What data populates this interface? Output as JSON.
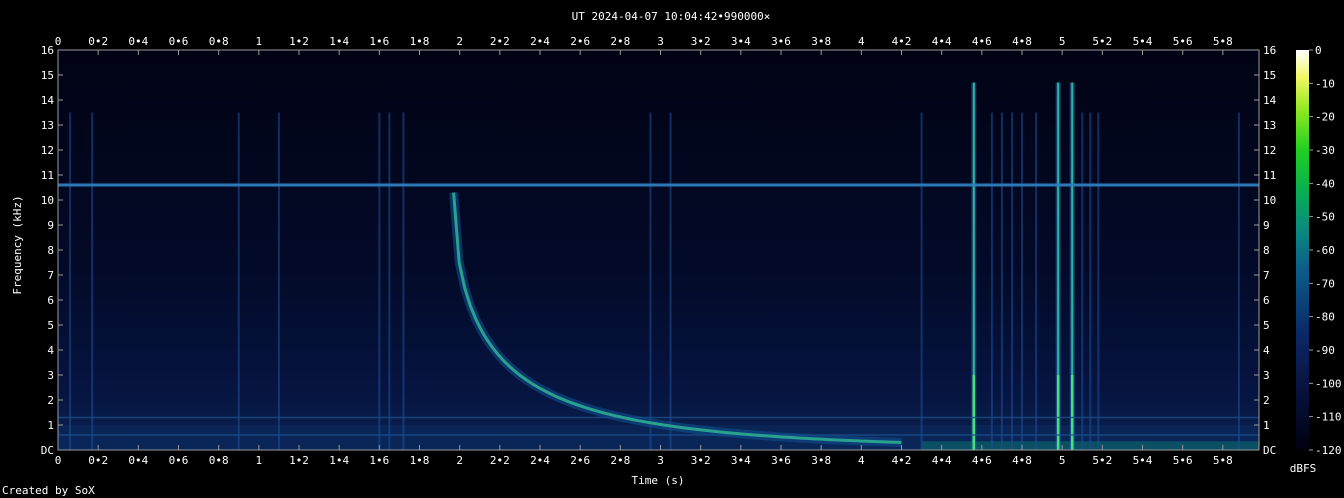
{
  "chart_data": {
    "type": "heatmap",
    "title": "UT 2024-04-07 10:04:42•990000×",
    "xlabel": "Time (s)",
    "ylabel": "Frequency (kHz)",
    "xlim": [
      0,
      5.98
    ],
    "ylim": [
      0,
      16
    ],
    "x_ticks": [
      "0",
      "0•2",
      "0•4",
      "0•6",
      "0•8",
      "1",
      "1•2",
      "1•4",
      "1•6",
      "1•8",
      "2",
      "2•2",
      "2•4",
      "2•6",
      "2•8",
      "3",
      "3•2",
      "3•4",
      "3•6",
      "3•8",
      "4",
      "4•2",
      "4•4",
      "4•6",
      "4•8",
      "5",
      "5•2",
      "5•4",
      "5•6",
      "5•8"
    ],
    "y_ticks": [
      "DC",
      "1",
      "2",
      "3",
      "4",
      "5",
      "6",
      "7",
      "8",
      "9",
      "10",
      "11",
      "12",
      "13",
      "14",
      "15",
      "16"
    ],
    "colorbar": {
      "label": "dBFS",
      "ticks": [
        "0",
        "-10",
        "-20",
        "-30",
        "-40",
        "-50",
        "-60",
        "-70",
        "-80",
        "-90",
        "-100",
        "-110",
        "-120"
      ],
      "range": [
        -120,
        0
      ]
    },
    "features": {
      "hum_lines_khz": [
        10.6,
        1.3,
        0.6
      ],
      "whistler": {
        "start_s": 1.97,
        "start_khz": 10.3,
        "end_s": 4.2,
        "end_khz": 0.3
      },
      "strong_impulses_s": [
        4.56,
        4.98,
        5.05
      ],
      "weak_impulses_s": [
        0.06,
        0.17,
        0.9,
        1.1,
        1.6,
        1.65,
        1.72,
        2.95,
        3.05,
        4.3,
        4.65,
        4.7,
        4.75,
        4.8,
        4.87,
        5.1,
        5.14,
        5.18,
        5.88
      ]
    }
  },
  "credit": "Created by SoX"
}
